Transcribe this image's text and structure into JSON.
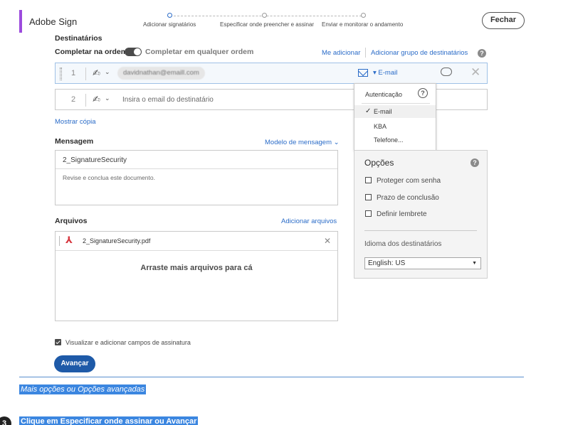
{
  "header": {
    "app_title": "Adobe Sign",
    "steps": [
      "Adicionar signatários",
      "Especificar onde preencher e assinar",
      "Enviar e monitorar o andamento"
    ],
    "close_label": "Fechar"
  },
  "recipients": {
    "section_label": "Destinatários",
    "order_label": "Completar na ordem",
    "any_order_label": "Completar em qualquer ordem",
    "add_me_link": "Me adicionar",
    "add_group_link": "Adicionar grupo de destinatários",
    "rows": [
      {
        "number": "1",
        "email": "davidnathan@emaill.com",
        "auth_label": "E-mail"
      },
      {
        "number": "2",
        "placeholder": "Insira o email do destinatário"
      }
    ],
    "show_cc_link": "Mostrar cópia"
  },
  "auth_menu": {
    "header": "Autenticação",
    "options": [
      "E-mail",
      "KBA",
      "Telefone..."
    ],
    "selected": "E-mail"
  },
  "message": {
    "section_label": "Mensagem",
    "template_link": "Modelo de mensagem",
    "subject": "2_SignatureSecurity",
    "body": "Revise e conclua este documento."
  },
  "options": {
    "title": "Opções",
    "items": [
      "Proteger com senha",
      "Prazo de conclusão",
      "Definir lembrete"
    ],
    "language_label": "Idioma dos destinatários",
    "language_value": "English: US"
  },
  "files": {
    "section_label": "Arquivos",
    "add_files_link": "Adicionar arquivos",
    "file_name": "2_SignatureSecurity.pdf",
    "drop_text": "Arraste mais arquivos para cá"
  },
  "preview_checkbox_label": "Visualizar e adicionar campos de assinatura",
  "next_button": "Avançar",
  "caption_highlight": "Mais opções ou Opções avançadas",
  "step_instruction": {
    "number": "3",
    "text": "Clique em Especificar onde assinar ou Avançar"
  }
}
